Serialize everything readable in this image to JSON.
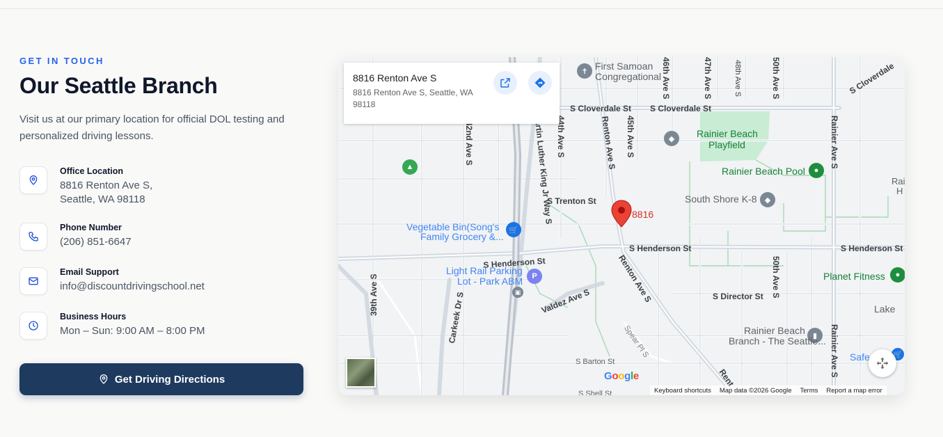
{
  "section": {
    "eyebrow": "GET IN TOUCH",
    "title": "Our Seattle Branch",
    "description": "Visit us at our primary location for official DOL testing and personalized driving lessons."
  },
  "info": [
    {
      "label": "Office Location",
      "value_line1": "8816 Renton Ave S,",
      "value_line2": "Seattle, WA 98118",
      "icon": "map-pin-icon"
    },
    {
      "label": "Phone Number",
      "value": "(206) 851-6647",
      "icon": "phone-icon"
    },
    {
      "label": "Email Support",
      "value": "info@discountdrivingschool.net",
      "icon": "mail-icon"
    },
    {
      "label": "Business Hours",
      "value": "Mon – Sun: 9:00 AM – 8:00 PM",
      "icon": "clock-icon"
    }
  ],
  "cta": {
    "label": "Get Driving Directions",
    "icon": "map-pin-icon"
  },
  "map": {
    "card": {
      "title": "8816 Renton Ave S",
      "address": "8816 Renton Ave S, Seattle, WA 98118"
    },
    "pin_label": "8816",
    "streets": {
      "cloverdale1": "S Cloverdale St",
      "cloverdale2": "S Cloverdale St",
      "cloverdale3": "S Cloverdale",
      "trenton": "S Trenton St",
      "henderson1": "S Henderson St",
      "henderson2": "S Henderson St",
      "henderson3": "S Henderson St",
      "director": "S Director St",
      "barton": "S Barton St",
      "shell": "S Shell St",
      "valdez": "Valdez Ave S",
      "renton": "Renton Ave S",
      "renton2": "Renton Ave S",
      "renton3": "Rent",
      "spear": "Spear Pl S",
      "carkeek": "Carkeek Dr S",
      "mlk": "Martin Luther King Jr Way S",
      "ave39": "39th Ave S",
      "ave42": "42nd Ave S",
      "ave44": "44th Ave S",
      "ave45": "45th Ave S",
      "ave46": "46th Ave S",
      "ave47": "47th Ave S",
      "ave48": "48th Ave S",
      "ave50a": "50th Ave S",
      "ave50b": "50th Ave S",
      "rainier1": "Rainier Ave S",
      "rainier2": "Rainier Ave S"
    },
    "places": {
      "samoan1": "First Samoan",
      "samoan2": "Congregational",
      "playfield1": "Rainier Beach",
      "playfield2": "Playfield",
      "pool": "Rainier Beach Pool",
      "southshore": "South Shore K-8",
      "veg1": "Vegetable Bin(Song's",
      "veg2": "Family Grocery &...",
      "rail1": "Light Rail Parking",
      "rail2": "Lot - Park ABM",
      "planet": "Planet Fitness",
      "lake": "Lake",
      "library1": "Rainier Beach",
      "library2": "Branch - The Seattle...",
      "safe": "Safe",
      "edge1": "Rai",
      "edge2": "H"
    },
    "google": "Google",
    "attribution": [
      "Keyboard shortcuts",
      "Map data ©2026 Google",
      "Terms",
      "Report a map error"
    ]
  },
  "colors": {
    "accent": "#2563eb",
    "button": "#1e3a5f",
    "pin": "#ea4335",
    "park": "#c8ecd4"
  }
}
